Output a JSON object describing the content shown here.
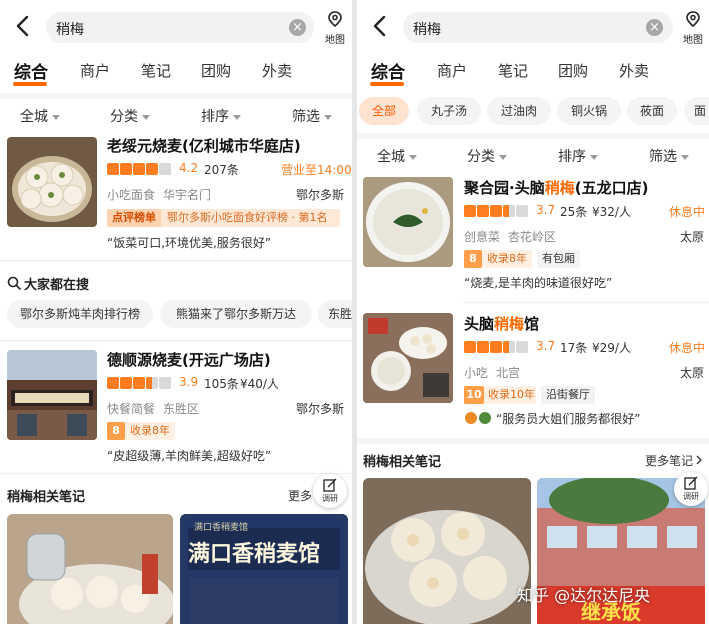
{
  "left": {
    "search": {
      "query": "稍梅"
    },
    "map_label": "地图",
    "tabs": [
      "综合",
      "商户",
      "笔记",
      "团购",
      "外卖"
    ],
    "filters": [
      "全城",
      "分类",
      "排序",
      "筛选"
    ],
    "shop1": {
      "name": "老绥元烧麦(亿利城市华庭店)",
      "stars": 4,
      "score": "4.2",
      "reviews": "207条",
      "status": "营业至14:00",
      "category": "小吃面食",
      "area": "华宇名门",
      "city": "鄂尔多斯",
      "rank_badge": "点评榜单",
      "rank_text": "鄂尔多斯小吃面食好评榜 · 第1名",
      "review": "“饭菜可口,环境优美,服务很好”"
    },
    "popular": {
      "title": "大家都在搜",
      "items": [
        "鄂尔多斯炖羊肉排行榜",
        "熊猫来了鄂尔多斯万达",
        "东胜"
      ]
    },
    "shop2": {
      "name": "德顺源烧麦(开远广场店)",
      "stars": 3.5,
      "score": "3.9",
      "reviews": "105条",
      "price": "¥40/人",
      "category": "快餐简餐",
      "area": "东胜区",
      "city": "鄂尔多斯",
      "years_num": "8",
      "years_text": "收录8年",
      "review": "“皮超级薄,羊肉鲜美,超级好吃”"
    },
    "notes": {
      "title": "稍梅相关笔记",
      "more": "更多",
      "fab": "调研",
      "image2_sign_sub": "满口香稍麦馆",
      "image2_sign": "满口香稍麦馆"
    }
  },
  "right": {
    "search": {
      "query": "稍梅"
    },
    "map_label": "地图",
    "tabs": [
      "综合",
      "商户",
      "笔记",
      "团购",
      "外卖"
    ],
    "chips": [
      "全部",
      "丸子汤",
      "过油肉",
      "铜火锅",
      "莜面",
      "面"
    ],
    "filters": [
      "全城",
      "分类",
      "排序",
      "筛选"
    ],
    "shop1": {
      "name_pre": "聚合园·头脑",
      "name_hl": "稍梅",
      "name_post": "(五龙口店)",
      "stars": 3.5,
      "score": "3.7",
      "reviews": "25条",
      "price": "¥32/人",
      "status": "休息中",
      "category": "创意菜",
      "area": "杏花岭区",
      "city": "太原",
      "years_num": "8",
      "years_text": "收录8年",
      "tag": "有包厢",
      "review": "“烧麦,是羊肉的味道很好吃”"
    },
    "shop2": {
      "name_pre": "头脑",
      "name_hl": "稍梅",
      "name_post": "馆",
      "stars": 3.5,
      "score": "3.7",
      "reviews": "17条",
      "price": "¥29/人",
      "status": "休息中",
      "category": "小吃",
      "area": "北宫",
      "city": "太原",
      "years_num": "10",
      "years_text": "收录10年",
      "tag": "沿街餐厅",
      "review": "“服务员大姐们服务都很好”"
    },
    "notes": {
      "title": "稍梅相关笔记",
      "more": "更多笔记",
      "fab": "调研",
      "watermark": "知乎 @达尔达尼央",
      "sign_text": "继承饭"
    }
  },
  "colors": {
    "accent": "#ff6a00",
    "star": "#ff7d1f",
    "rank_bg": "#ffe8d6",
    "search_bg": "#f2f2f2"
  }
}
